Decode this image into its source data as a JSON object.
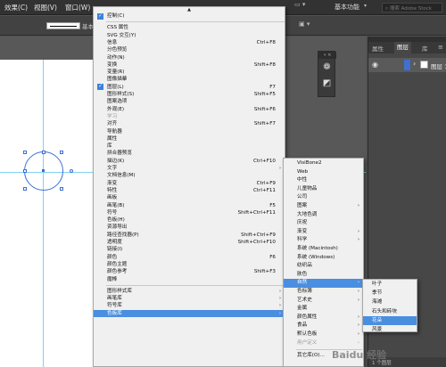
{
  "menubar": {
    "items": [
      "效果(C)",
      "视图(V)",
      "窗口(W)"
    ],
    "workspace": "基本功能",
    "search_placeholder": "搜索 Adobe Stock"
  },
  "control_bar": {
    "stroke_label": "基本"
  },
  "window_menu": {
    "items": [
      {
        "label": "控制(C)",
        "checked": true
      },
      {
        "sep": true
      },
      {
        "label": "CSS 属性"
      },
      {
        "label": "SVG 交互(Y)"
      },
      {
        "label": "信息",
        "shortcut": "Ctrl+F8"
      },
      {
        "label": "分色预览"
      },
      {
        "label": "动作(N)"
      },
      {
        "label": "变换",
        "shortcut": "Shift+F8"
      },
      {
        "label": "变量(R)"
      },
      {
        "label": "图像描摹"
      },
      {
        "label": "图层(L)",
        "shortcut": "F7",
        "checked": true
      },
      {
        "label": "图形样式(S)",
        "shortcut": "Shift+F5"
      },
      {
        "label": "图案选项"
      },
      {
        "label": "外观(E)",
        "shortcut": "Shift+F6"
      },
      {
        "label": "学习",
        "disabled": true
      },
      {
        "label": "对齐",
        "shortcut": "Shift+F7"
      },
      {
        "label": "导航器"
      },
      {
        "label": "属性"
      },
      {
        "label": "库"
      },
      {
        "label": "拼合器预览"
      },
      {
        "label": "描边(K)",
        "shortcut": "Ctrl+F10"
      },
      {
        "label": "文字",
        "submenu": true
      },
      {
        "label": "文档信息(M)"
      },
      {
        "label": "渐变",
        "shortcut": "Ctrl+F9"
      },
      {
        "label": "特性",
        "shortcut": "Ctrl+F11"
      },
      {
        "label": "画板"
      },
      {
        "label": "画笔(B)",
        "shortcut": "F5"
      },
      {
        "label": "符号",
        "shortcut": "Shift+Ctrl+F11"
      },
      {
        "label": "色板(H)"
      },
      {
        "label": "资源导出"
      },
      {
        "label": "路径查找器(P)",
        "shortcut": "Shift+Ctrl+F9"
      },
      {
        "label": "透明度",
        "shortcut": "Shift+Ctrl+F10"
      },
      {
        "label": "链接(I)"
      },
      {
        "label": "颜色",
        "shortcut": "F6"
      },
      {
        "label": "颜色主题"
      },
      {
        "label": "颜色参考",
        "shortcut": "Shift+F3"
      },
      {
        "label": "魔棒"
      },
      {
        "sep": true
      },
      {
        "label": "图形样式库",
        "submenu": true
      },
      {
        "label": "画笔库",
        "submenu": true
      },
      {
        "label": "符号库",
        "submenu": true
      },
      {
        "label": "色板库",
        "submenu": true,
        "highlighted": true
      }
    ]
  },
  "swatch_lib_menu": {
    "items": [
      {
        "label": "VisiBone2"
      },
      {
        "label": "Web"
      },
      {
        "label": "中性"
      },
      {
        "label": "儿童物品"
      },
      {
        "label": "公司"
      },
      {
        "label": "图案",
        "submenu": true
      },
      {
        "label": "大地色调"
      },
      {
        "label": "庆祝"
      },
      {
        "label": "渐变",
        "submenu": true
      },
      {
        "label": "科学",
        "submenu": true
      },
      {
        "label": "系统 (Macintosh)"
      },
      {
        "label": "系统 (Windows)"
      },
      {
        "label": "纺织品"
      },
      {
        "label": "肤色"
      },
      {
        "label": "自然",
        "submenu": true,
        "highlighted": true
      },
      {
        "label": "色标簿",
        "submenu": true
      },
      {
        "label": "艺术史",
        "submenu": true
      },
      {
        "label": "金属"
      },
      {
        "label": "颜色属性",
        "submenu": true
      },
      {
        "label": "食品",
        "submenu": true
      },
      {
        "label": "默认色板",
        "submenu": true
      },
      {
        "label": "用户定义",
        "submenu": true,
        "disabled": true
      },
      {
        "sep": true
      },
      {
        "label": "其它库(O)..."
      }
    ]
  },
  "nature_menu": {
    "items": [
      {
        "label": "叶子"
      },
      {
        "label": "季节"
      },
      {
        "label": "海滩"
      },
      {
        "label": "石头和砖块"
      },
      {
        "label": "花朵",
        "highlighted": true
      },
      {
        "label": "风景"
      }
    ]
  },
  "layers_panel": {
    "tabs": [
      "属性",
      "图层",
      "库"
    ],
    "layer_name": "图层 1",
    "bottom_text": "1 个图层"
  },
  "colors": {
    "highlight": "#4a8ee0",
    "layer_color": "#3f6fcf",
    "guide": "#7fd2f0",
    "selection": "#3a6ed8"
  },
  "watermark": "Baidu 经验"
}
